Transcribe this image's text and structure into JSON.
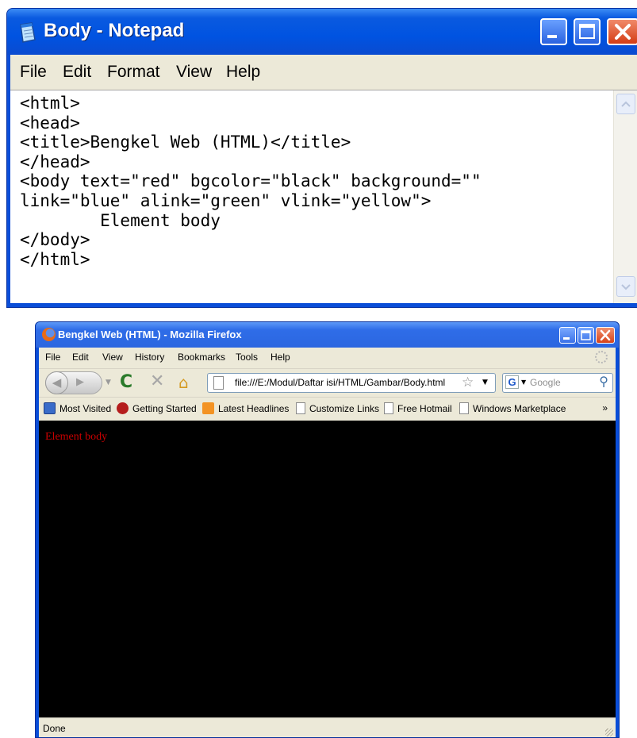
{
  "notepad": {
    "title": "Body - Notepad",
    "menu": [
      "File",
      "Edit",
      "Format",
      "View",
      "Help"
    ],
    "content": "<html>\n<head>\n<title>Bengkel Web (HTML)</title>\n</head>\n<body text=\"red\" bgcolor=\"black\" background=\"\"\nlink=\"blue\" alink=\"green\" vlink=\"yellow\">\n        Element body\n</body>\n</html>"
  },
  "firefox": {
    "title": "Bengkel Web (HTML) - Mozilla Firefox",
    "menu": [
      "File",
      "Edit",
      "View",
      "History",
      "Bookmarks",
      "Tools",
      "Help"
    ],
    "url": "file:///E:/Modul/Daftar isi/HTML/Gambar/Body.html",
    "search_engine_icon": "G",
    "search_placeholder": "Google",
    "bookmarks": [
      {
        "label": "Most Visited",
        "icon": "most-visited-icon"
      },
      {
        "label": "Getting Started",
        "icon": "getting-started-icon"
      },
      {
        "label": "Latest Headlines",
        "icon": "rss-icon"
      },
      {
        "label": "Customize Links",
        "icon": "page-icon"
      },
      {
        "label": "Free Hotmail",
        "icon": "page-icon"
      },
      {
        "label": "Windows Marketplace",
        "icon": "page-icon"
      }
    ],
    "bookmarks_overflow": "»",
    "page_text": "Element body",
    "page_text_color": "#cc0000",
    "page_bg_color": "#000000",
    "status": "Done"
  }
}
